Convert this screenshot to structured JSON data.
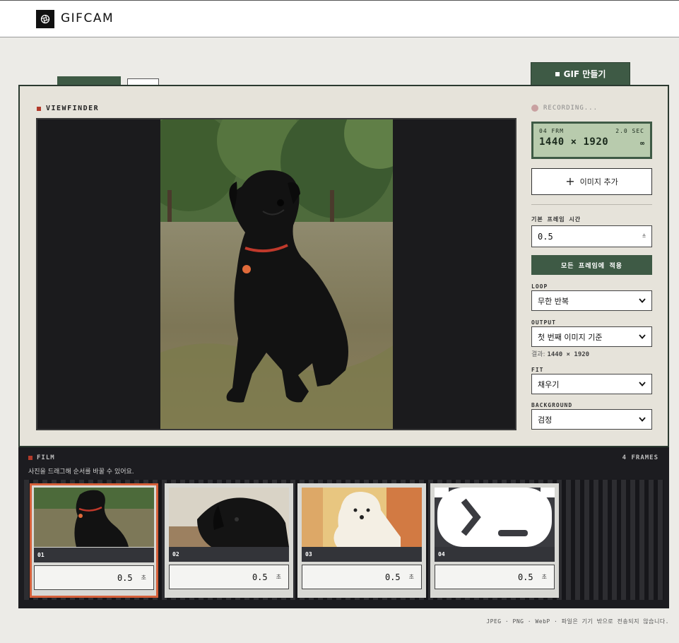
{
  "app": {
    "brand": "GIFCAM",
    "make_gif_label": "GIF 만들기"
  },
  "viewfinder": {
    "title": "VIEWFINDER"
  },
  "status": {
    "recording": "RECORDING..."
  },
  "lcd": {
    "frames": "04 FRM",
    "duration": "2.0 SEC",
    "dimensions": "1440 × 1920",
    "loop_symbol": "∞"
  },
  "controls": {
    "add_image": "이미지 추가",
    "default_frame_time_label": "기본 프레임 시간",
    "default_frame_time_value": "0.5",
    "apply_all_label": "모든 프레임에 적용",
    "loop_label": "LOOP",
    "loop_value": "무한 반복",
    "output_label": "OUTPUT",
    "output_value": "첫 번째 이미지 기준",
    "result_prefix": "결과:",
    "result_value": "1440 × 1920",
    "fit_label": "FIT",
    "fit_value": "채우기",
    "background_label": "BACKGROUND",
    "background_value": "검정"
  },
  "film": {
    "title": "FILM",
    "count": "4 FRAMES",
    "hint": "사진을 드래그해 순서를 바꿀 수 있어요.",
    "unit": "초",
    "frames": [
      {
        "num": "01",
        "duration": "0.5",
        "image": "black-labrador-sitting-on-grass"
      },
      {
        "num": "02",
        "duration": "0.5",
        "image": "black-labrador-lying-down"
      },
      {
        "num": "03",
        "duration": "0.5",
        "image": "white-puppy"
      },
      {
        "num": "04",
        "duration": "0.5",
        "image": "terminal-prompt-icon"
      }
    ]
  },
  "footer": {
    "note": "JPEG · PNG · WebP · 파일은 기기 밖으로 전송되지 않습니다."
  },
  "colors": {
    "accent_green": "#3e5a45",
    "accent_red": "#b23a2a",
    "selected_border": "#d6603a",
    "lcd_bg": "#b8cbad"
  }
}
